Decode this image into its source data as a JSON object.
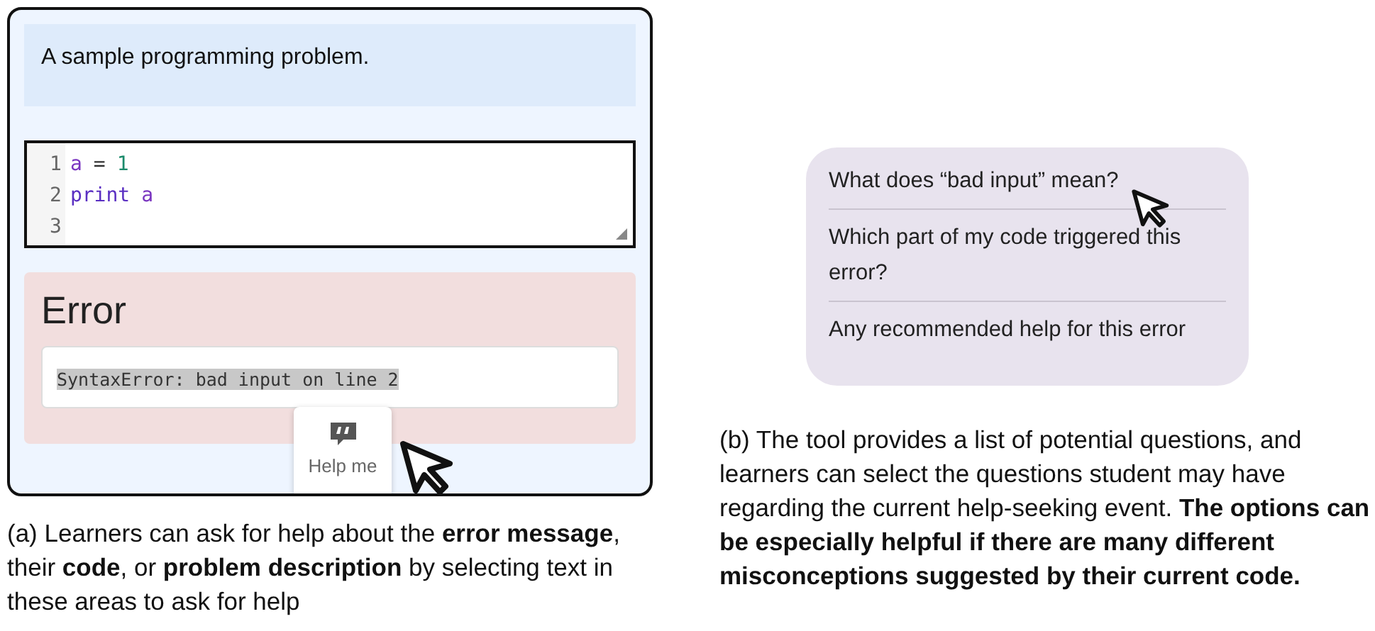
{
  "problem": {
    "description": "A sample programming problem."
  },
  "editor": {
    "lines": [
      {
        "number": "1",
        "tokens": [
          {
            "kind": "variable",
            "text": "a"
          },
          {
            "kind": "operator",
            "text": "="
          },
          {
            "kind": "number",
            "text": "1"
          }
        ]
      },
      {
        "number": "2",
        "tokens": [
          {
            "kind": "keyword",
            "text": "print"
          },
          {
            "kind": "variable",
            "text": "a"
          }
        ]
      },
      {
        "number": "3"
      }
    ]
  },
  "error": {
    "heading": "Error",
    "message": "SyntaxError: bad input on line 2",
    "selected": true
  },
  "help_popover": {
    "label": "Help me"
  },
  "questions": [
    {
      "text": "What does “bad input” mean?"
    },
    {
      "text": "Which part of my code triggered this error?"
    },
    {
      "text": "Any recommended help for this error"
    }
  ],
  "captions": [
    {
      "text": "(a) Learners can ask for help about the **error message**, their **code**, or **problem description** by selecting text in these areas to ask for help"
    },
    {
      "text": "(b) The tool provides a list of potential questions, and learners can select the questions student may have regarding the current help-seeking event. **The options can be especially helpful if there are many different misconceptions suggested by their current code.**"
    }
  ]
}
